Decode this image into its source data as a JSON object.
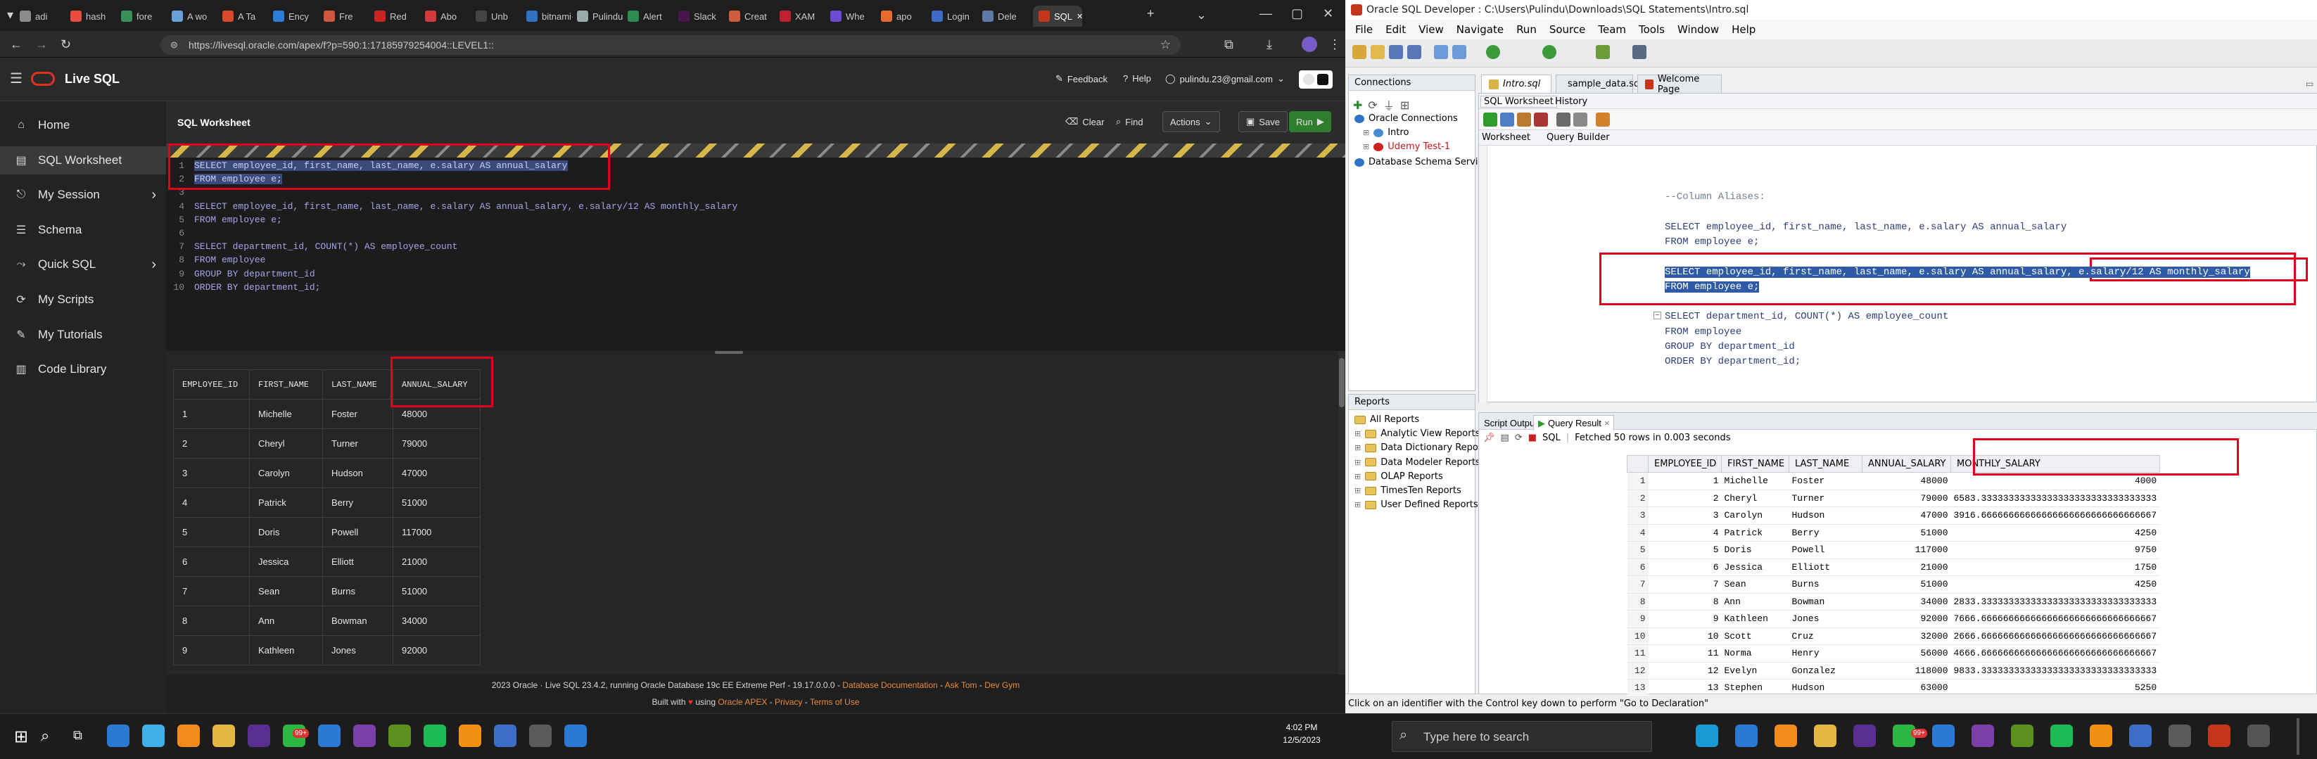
{
  "browser": {
    "tabs": [
      "adi",
      "hash",
      "fore",
      "A wo",
      "A Ta",
      "Ency",
      "Fre",
      "Red",
      "Abo",
      "Unb",
      "bitnami·",
      "Pulindu",
      "Alert",
      "Slack",
      "Creat",
      "XAM",
      "Whe",
      "apo",
      "Login",
      "Dele",
      "SQL"
    ],
    "url": "https://livesql.oracle.com/apex/f?p=590:1:17185979254004::LEVEL1::"
  },
  "livesql": {
    "brand": "Live SQL",
    "header_links": {
      "feedback": "Feedback",
      "help": "Help",
      "user": "pulindu.23@gmail.com"
    },
    "sidebar": [
      {
        "label": "Home",
        "icon": "home-icon"
      },
      {
        "label": "SQL Worksheet",
        "icon": "worksheet-icon"
      },
      {
        "label": "My Session",
        "icon": "session-icon"
      },
      {
        "label": "Schema",
        "icon": "schema-icon"
      },
      {
        "label": "Quick SQL",
        "icon": "quicksql-icon"
      },
      {
        "label": "My Scripts",
        "icon": "scripts-icon"
      },
      {
        "label": "My Tutorials",
        "icon": "tutorials-icon"
      },
      {
        "label": "Code Library",
        "icon": "library-icon"
      }
    ],
    "worksheet_title": "SQL Worksheet",
    "toolbar": {
      "clear": "Clear",
      "find": "Find",
      "actions": "Actions",
      "save": "Save",
      "run": "Run"
    },
    "code_lines": [
      "SELECT employee_id, first_name, last_name, e.salary AS annual_salary",
      "FROM employee e;",
      "",
      "SELECT employee_id, first_name, last_name, e.salary AS annual_salary, e.salary/12 AS monthly_salary",
      "FROM employee e;",
      "",
      "SELECT department_id, COUNT(*) AS employee_count",
      "FROM employee",
      "GROUP BY department_id",
      "ORDER BY department_id;"
    ],
    "result_columns": [
      "EMPLOYEE_ID",
      "FIRST_NAME",
      "LAST_NAME",
      "ANNUAL_SALARY"
    ],
    "result_rows": [
      [
        "1",
        "Michelle",
        "Foster",
        "48000"
      ],
      [
        "2",
        "Cheryl",
        "Turner",
        "79000"
      ],
      [
        "3",
        "Carolyn",
        "Hudson",
        "47000"
      ],
      [
        "4",
        "Patrick",
        "Berry",
        "51000"
      ],
      [
        "5",
        "Doris",
        "Powell",
        "117000"
      ],
      [
        "6",
        "Jessica",
        "Elliott",
        "21000"
      ],
      [
        "7",
        "Sean",
        "Burns",
        "51000"
      ],
      [
        "8",
        "Ann",
        "Bowman",
        "34000"
      ],
      [
        "9",
        "Kathleen",
        "Jones",
        "92000"
      ]
    ],
    "footer_line1_prefix": "2023 Oracle · Live SQL 23.4.2, running Oracle Database 19c EE Extreme Perf - 19.17.0.0.0 - ",
    "footer_links_1": [
      "Database Documentation",
      "Ask Tom",
      "Dev Gym"
    ],
    "footer_line2_prefix": "Built with",
    "footer_line2_mid": "using",
    "footer_links_2": [
      "Oracle APEX",
      "Privacy",
      "Terms of Use"
    ]
  },
  "sqldev": {
    "title": "Oracle SQL Developer : C:\\Users\\Pulindu\\Downloads\\SQL Statements\\Intro.sql",
    "menu": [
      "File",
      "Edit",
      "View",
      "Navigate",
      "Run",
      "Source",
      "Team",
      "Tools",
      "Window",
      "Help"
    ],
    "connections_title": "Connections",
    "connections_tree": [
      "Oracle Connections",
      "Intro",
      "Udemy Test-1",
      "Database Schema Service Connections"
    ],
    "reports_title": "Reports",
    "reports_tree": [
      "All Reports",
      "Analytic View Reports",
      "Data Dictionary Reports",
      "Data Modeler Reports",
      "OLAP Reports",
      "TimesTen Reports",
      "User Defined Reports"
    ],
    "editor_tabs": [
      "Intro.sql",
      "sample_data.sql",
      "Welcome Page"
    ],
    "worksheet_tabs": [
      "SQL Worksheet",
      "History"
    ],
    "sub_tabs": [
      "Worksheet",
      "Query Builder"
    ],
    "code_lines": [
      "--Column Aliases:",
      "",
      "SELECT employee_id, first_name, last_name, e.salary AS annual_salary",
      "FROM employee e;",
      "",
      "SELECT employee_id, first_name, last_name, e.salary AS annual_salary, e.salary/12 AS monthly_salary",
      "FROM employee e;",
      "",
      "SELECT department_id, COUNT(*) AS employee_count",
      "FROM employee",
      "GROUP BY department_id",
      "ORDER BY department_id;"
    ],
    "output_tabs": [
      "Script Output",
      "Query Result"
    ],
    "output_sql_label": "SQL",
    "fetch_status": "Fetched 50 rows in 0.003 seconds",
    "grid_columns": [
      "EMPLOYEE_ID",
      "FIRST_NAME",
      "LAST_NAME",
      "ANNUAL_SALARY",
      "MONTHLY_SALARY"
    ],
    "grid_rows": [
      [
        "1",
        "1",
        "Michelle",
        "Foster",
        "48000",
        "4000"
      ],
      [
        "2",
        "2",
        "Cheryl",
        "Turner",
        "79000",
        "6583.33333333333333333333333333333333"
      ],
      [
        "3",
        "3",
        "Carolyn",
        "Hudson",
        "47000",
        "3916.66666666666666666666666666666667"
      ],
      [
        "4",
        "4",
        "Patrick",
        "Berry",
        "51000",
        "4250"
      ],
      [
        "5",
        "5",
        "Doris",
        "Powell",
        "117000",
        "9750"
      ],
      [
        "6",
        "6",
        "Jessica",
        "Elliott",
        "21000",
        "1750"
      ],
      [
        "7",
        "7",
        "Sean",
        "Burns",
        "51000",
        "4250"
      ],
      [
        "8",
        "8",
        "Ann",
        "Bowman",
        "34000",
        "2833.33333333333333333333333333333333"
      ],
      [
        "9",
        "9",
        "Kathleen",
        "Jones",
        "92000",
        "7666.66666666666666666666666666666667"
      ],
      [
        "10",
        "10",
        "Scott",
        "Cruz",
        "32000",
        "2666.66666666666666666666666666666667"
      ],
      [
        "11",
        "11",
        "Norma",
        "Henry",
        "56000",
        "4666.66666666666666666666666666666667"
      ],
      [
        "12",
        "12",
        "Evelyn",
        "Gonzalez",
        "118000",
        "9833.33333333333333333333333333333333"
      ],
      [
        "13",
        "13",
        "Stephen",
        "Hudson",
        "63000",
        "5250"
      ]
    ],
    "status_bar": "Click on an identifier with the Control key down to perform \"Go to Declaration\""
  },
  "taskbar": {
    "search_placeholder": "Type here to search",
    "time": "4:02 PM",
    "date": "12/5/2023",
    "whatsapp_badge": "99+"
  },
  "colors": {
    "red_annotation": "#e0001b",
    "run_button": "#2f7d2f",
    "selection": "#2f5aa6"
  }
}
